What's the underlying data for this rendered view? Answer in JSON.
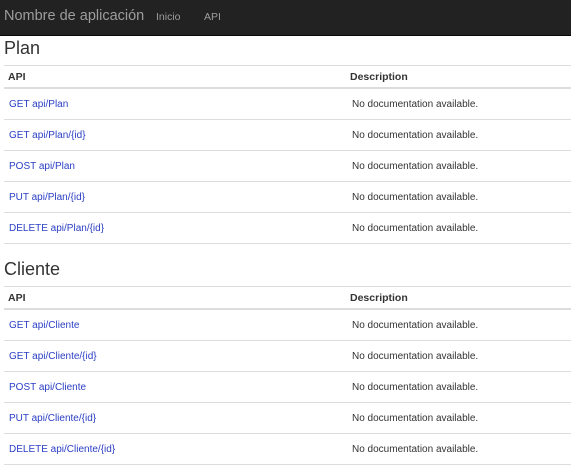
{
  "navbar": {
    "brand": "Nombre de aplicación",
    "links": [
      "Inicio",
      "API"
    ]
  },
  "sections": [
    {
      "title": "Plan",
      "columns": [
        "API",
        "Description"
      ],
      "rows": [
        {
          "api": "GET api/Plan",
          "description": "No documentation available."
        },
        {
          "api": "GET api/Plan/{id}",
          "description": "No documentation available."
        },
        {
          "api": "POST api/Plan",
          "description": "No documentation available."
        },
        {
          "api": "PUT api/Plan/{id}",
          "description": "No documentation available."
        },
        {
          "api": "DELETE api/Plan/{id}",
          "description": "No documentation available."
        }
      ]
    },
    {
      "title": "Cliente",
      "columns": [
        "API",
        "Description"
      ],
      "rows": [
        {
          "api": "GET api/Cliente",
          "description": "No documentation available."
        },
        {
          "api": "GET api/Cliente/{id}",
          "description": "No documentation available."
        },
        {
          "api": "POST api/Cliente",
          "description": "No documentation available."
        },
        {
          "api": "PUT api/Cliente/{id}",
          "description": "No documentation available."
        },
        {
          "api": "DELETE api/Cliente/{id}",
          "description": "No documentation available."
        }
      ]
    }
  ],
  "colors": {
    "navbar_bg": "#222222",
    "navbar_text": "#9d9d9d",
    "link": "#2a3ec4",
    "border": "#dddddd"
  }
}
